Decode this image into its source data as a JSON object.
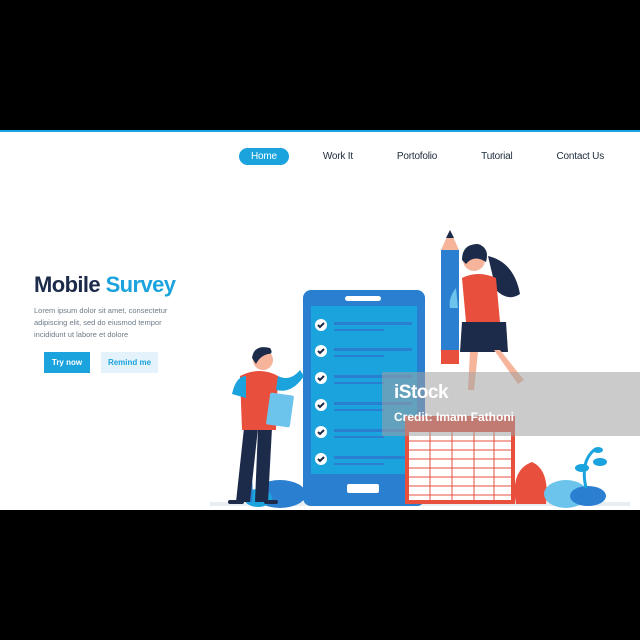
{
  "nav": {
    "items": [
      {
        "label": "Home",
        "active": true
      },
      {
        "label": "Work It",
        "active": false
      },
      {
        "label": "Portofolio",
        "active": false
      },
      {
        "label": "Tutorial",
        "active": false
      },
      {
        "label": "Contact Us",
        "active": false
      }
    ]
  },
  "hero": {
    "title_part1": "Mobile",
    "title_part2": "Survey",
    "description": "Lorem ipsum dolor sit amet, consectetur adipiscing elit, sed do eiusmod tempor incididunt ut labore et dolore",
    "primary_button": "Try now",
    "secondary_button": "Remind me"
  },
  "watermark": {
    "logo": "iStock",
    "credit": "Credit: Imam Fathoni"
  },
  "colors": {
    "accent": "#1ba3dd",
    "dark_navy": "#1c2b4a",
    "coral": "#e84f3c"
  }
}
